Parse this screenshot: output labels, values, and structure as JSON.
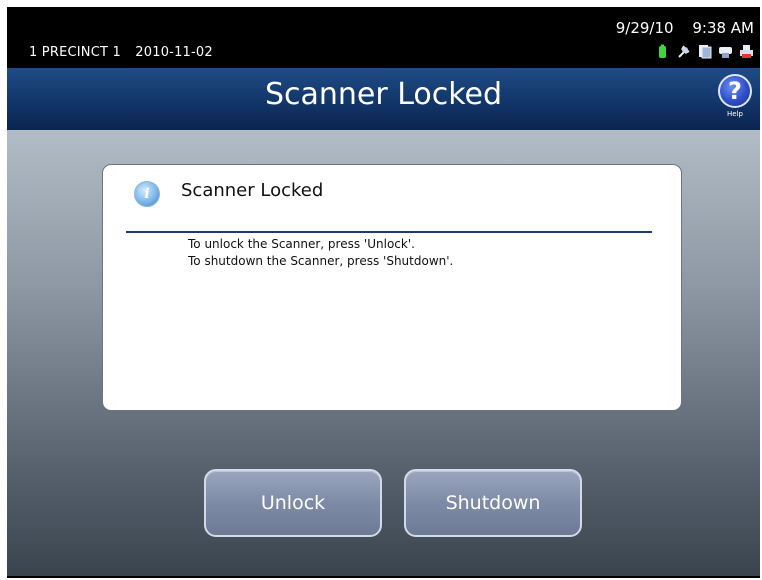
{
  "status": {
    "precinct": "1 PRECINCT 1",
    "election_date": "2010-11-02",
    "date": "9/29/10",
    "time": "9:38 AM",
    "icons": [
      "battery-icon",
      "power-plug-icon",
      "document-icon",
      "ballot-box-icon",
      "printer-icon"
    ]
  },
  "header": {
    "title": "Scanner Locked",
    "help_label": "Help",
    "help_symbol": "?"
  },
  "dialog": {
    "info_symbol": "i",
    "title": "Scanner Locked",
    "lines": [
      "To unlock the Scanner, press 'Unlock'.",
      "To shutdown the Scanner, press 'Shutdown'."
    ]
  },
  "buttons": {
    "unlock": "Unlock",
    "shutdown": "Shutdown"
  },
  "colors": {
    "titlebar": "#13386c",
    "button": "#7e8ba6",
    "divider": "#1c3c6a",
    "battery": "#3fd63f"
  }
}
